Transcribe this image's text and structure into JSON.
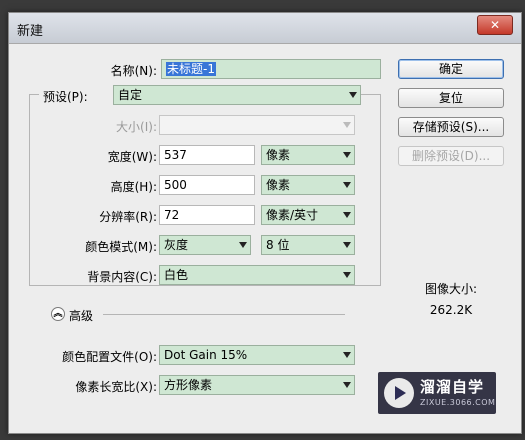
{
  "window": {
    "title": "新建",
    "close_symbol": "✕"
  },
  "form": {
    "name": {
      "label": "名称(N):",
      "value": "未标题-1"
    },
    "preset": {
      "label": "预设(P):",
      "value": "自定"
    },
    "size": {
      "label": "大小(I):",
      "value": ""
    },
    "width": {
      "label": "宽度(W):",
      "value": "537",
      "unit": "像素"
    },
    "height": {
      "label": "高度(H):",
      "value": "500",
      "unit": "像素"
    },
    "resolution": {
      "label": "分辨率(R):",
      "value": "72",
      "unit": "像素/英寸"
    },
    "color_mode": {
      "label": "颜色模式(M):",
      "value": "灰度",
      "bits": "8 位"
    },
    "background": {
      "label": "背景内容(C):",
      "value": "白色"
    },
    "advanced": {
      "label": "高级",
      "toggle": "︽"
    },
    "color_profile": {
      "label": "颜色配置文件(O):",
      "value": "Dot Gain 15%"
    },
    "pixel_aspect": {
      "label": "像素长宽比(X):",
      "value": "方形像素"
    }
  },
  "buttons": {
    "ok": "确定",
    "reset": "复位",
    "save_preset": "存储预设(S)...",
    "delete_preset": "删除预设(D)..."
  },
  "image_size": {
    "label": "图像大小:",
    "value": "262.2K"
  },
  "watermark": {
    "title": "溜溜自学",
    "subtitle": "ZIXUE.3066.COM"
  }
}
